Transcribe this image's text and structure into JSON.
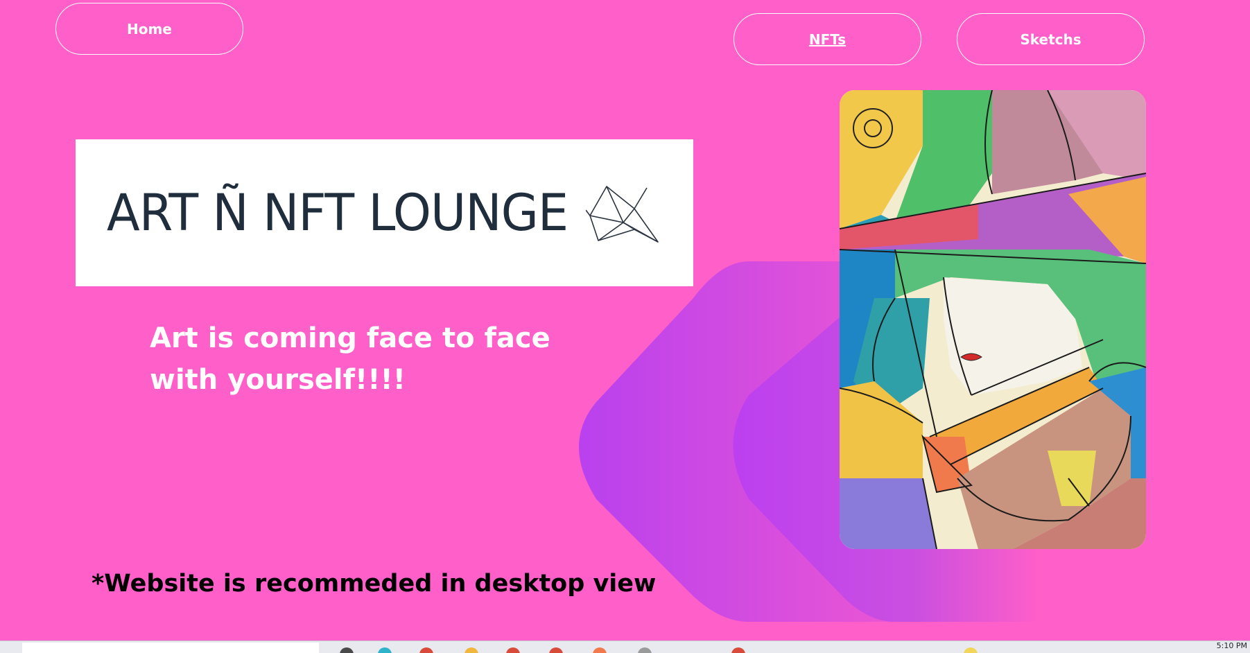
{
  "nav": {
    "home_label": "Home",
    "nfts_label": "NFTs",
    "sketchs_label": "Sketchs"
  },
  "logo": {
    "text": "ART Ñ NFT LOUNGE",
    "icon": "origami-crane-icon"
  },
  "hero": {
    "tagline_line1": "Art is coming face to face",
    "tagline_line2": "with yourself!!!!"
  },
  "footer_note": "*Website is recommeded in desktop view",
  "taskbar": {
    "time": "5:10 PM"
  },
  "colors": {
    "background": "#ff5fc8",
    "accent_purple": "#b53ff0",
    "text_white": "#ffffff",
    "text_black": "#000000"
  }
}
